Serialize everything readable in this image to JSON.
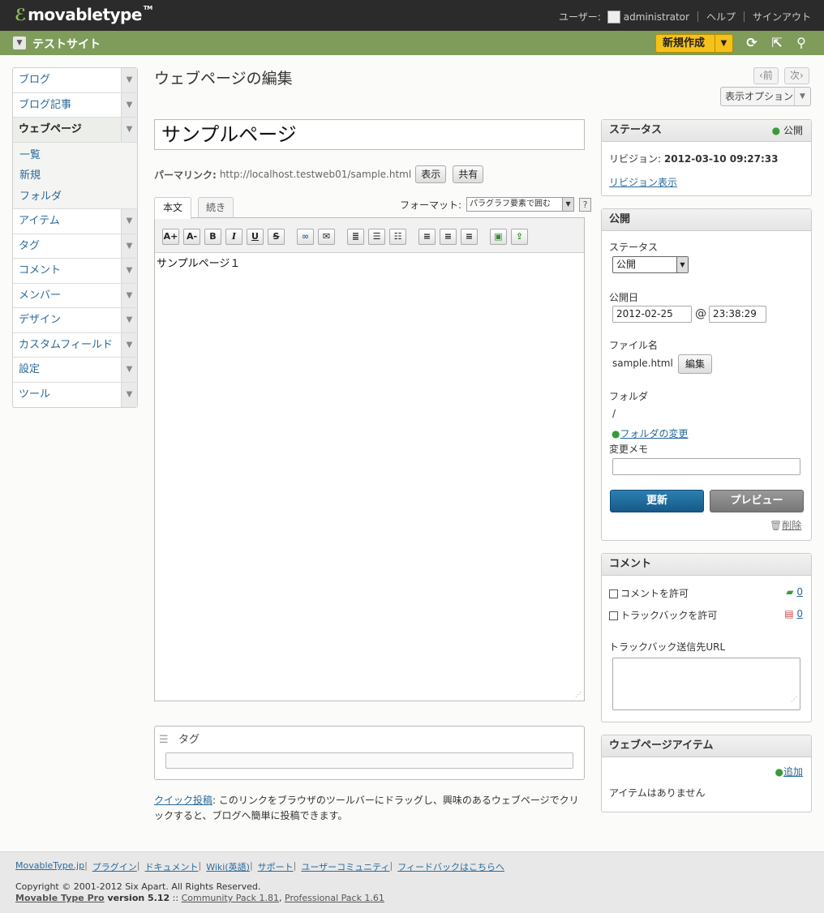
{
  "app": {
    "logo": "movabletype",
    "logo_tm": "TM"
  },
  "user_nav": {
    "user_label": "ユーザー:",
    "username": "administrator",
    "help": "ヘルプ",
    "signout": "サインアウト"
  },
  "site": {
    "name": "テストサイト",
    "new_button": "新規作成"
  },
  "sidebar": {
    "items": [
      {
        "label": "ブログ"
      },
      {
        "label": "ブログ記事"
      },
      {
        "label": "ウェブページ"
      },
      {
        "label": "アイテム"
      },
      {
        "label": "タグ"
      },
      {
        "label": "コメント"
      },
      {
        "label": "メンバー"
      },
      {
        "label": "デザイン"
      },
      {
        "label": "カスタムフィールド"
      },
      {
        "label": "設定"
      },
      {
        "label": "ツール"
      }
    ],
    "sub_items": [
      {
        "label": "一覧"
      },
      {
        "label": "新規"
      },
      {
        "label": "フォルダ"
      }
    ]
  },
  "page": {
    "title": "ウェブページの編集",
    "prev": "‹前",
    "next": "次›",
    "display_options": "表示オプション"
  },
  "entry": {
    "title": "サンプルページ",
    "permalink_label": "パーマリンク:",
    "permalink_url": "http://localhost.testweb01/sample.html",
    "view_button": "表示",
    "share_button": "共有",
    "tabs": [
      {
        "label": "本文"
      },
      {
        "label": "続き"
      }
    ],
    "format_label": "フォーマット:",
    "format_value": "パラグラフ要素で囲む",
    "help": "?",
    "body": "サンプルページ１"
  },
  "tags": {
    "label": "タグ",
    "value": ""
  },
  "quickpost": {
    "link": "クイック投稿",
    "text": ": このリンクをブラウザのツールバーにドラッグし、興味のあるウェブページでクリックすると、ブログへ簡単に投稿できます。"
  },
  "status_panel": {
    "title": "ステータス",
    "status": "公開",
    "revision_label": "リビジョン:",
    "revision_value": "2012-03-10 09:27:33",
    "revision_link": "リビジョン表示"
  },
  "publish_panel": {
    "title": "公開",
    "status_label": "ステータス",
    "status_value": "公開",
    "date_label": "公開日",
    "date_value": "2012-02-25",
    "at": "@",
    "time_value": "23:38:29",
    "filename_label": "ファイル名",
    "filename_value": "sample.html",
    "edit_button": "編集",
    "folder_label": "フォルダ",
    "folder_value": "/",
    "folder_change": "フォルダの変更",
    "memo_label": "変更メモ",
    "memo_value": "",
    "update_button": "更新",
    "preview_button": "プレビュー",
    "delete_link": "削除"
  },
  "comment_panel": {
    "title": "コメント",
    "allow_comments": "コメントを許可",
    "comment_count": "0",
    "allow_trackbacks": "トラックバックを許可",
    "trackback_count": "0",
    "trackback_url_label": "トラックバック送信先URL"
  },
  "assets_panel": {
    "title": "ウェブページアイテム",
    "add": "追加",
    "empty": "アイテムはありません"
  },
  "footer": {
    "links": [
      {
        "label": "MovableType.jp"
      },
      {
        "label": "プラグイン"
      },
      {
        "label": "ドキュメント"
      },
      {
        "label": "Wiki(英語)"
      },
      {
        "label": "サポート"
      },
      {
        "label": "ユーザーコミュニティ"
      },
      {
        "label": "フィードバックはこちらへ"
      }
    ],
    "copyright": "Copyright © 2001-2012 Six Apart. All Rights Reserved.",
    "product": "Movable Type Pro",
    "version": " version 5.12",
    "sep": " :: ",
    "community_pack": "Community Pack 1.81",
    "comma": ", ",
    "professional_pack": "Professional Pack 1.61"
  },
  "colors": {
    "topbar": "#2b2b2b",
    "sitebar": "#7f9c5b",
    "new_button": "#f5c11a",
    "update_button": "#1d6a9a",
    "preview_button": "#888888"
  }
}
